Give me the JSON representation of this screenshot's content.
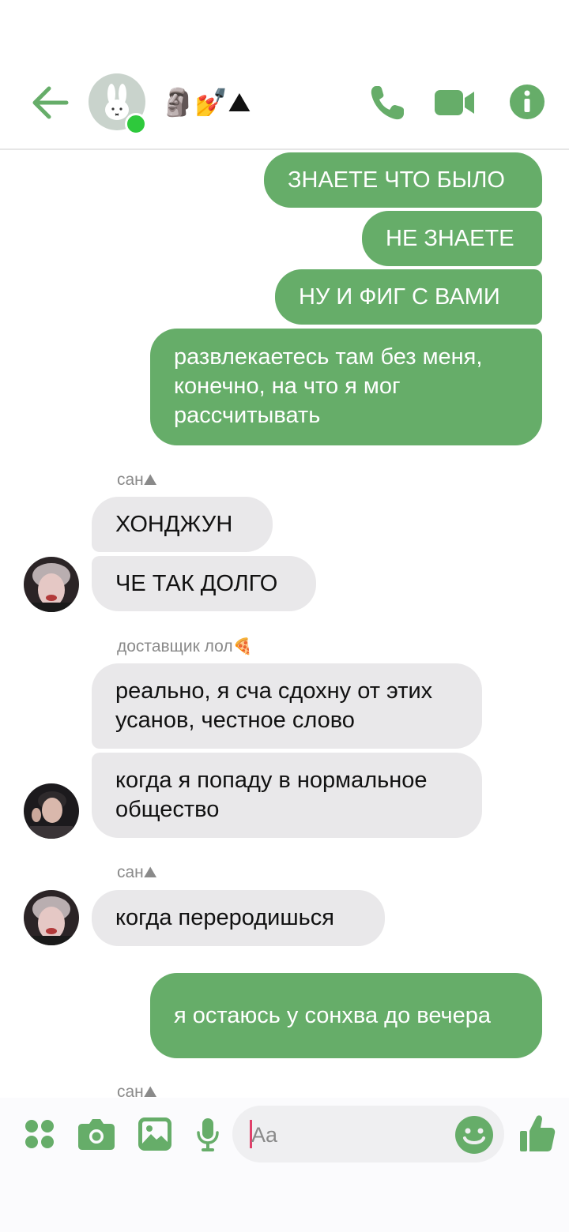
{
  "header": {
    "chat_title": "🗿💅⛰",
    "back_icon": "arrow-left-icon",
    "call_icon": "phone-icon",
    "video_icon": "video-camera-icon",
    "info_icon": "info-icon",
    "accent_color": "#66ad69"
  },
  "messages": [
    {
      "side": "out",
      "text": "ЗНАЕТЕ ЧТО БЫЛО"
    },
    {
      "side": "out",
      "text": "НЕ ЗНАЕТЕ"
    },
    {
      "side": "out",
      "text": "НУ И ФИГ С ВАМИ"
    },
    {
      "side": "out",
      "text": "развлекаетесь там без меня, конечно, на что я мог рассчитывать"
    },
    {
      "side": "in",
      "sender": "сан",
      "sender_emoji": "⛰",
      "texts": [
        "ХОНДЖУН",
        "ЧЕ ТАК ДОЛГО"
      ]
    },
    {
      "side": "in",
      "sender": "доставщик лол",
      "sender_emoji": "🍕",
      "texts": [
        "реально, я сча сдохну от этих усанов, честное слово",
        "когда я попаду в нормальное общество"
      ]
    },
    {
      "side": "in",
      "sender": "сан",
      "sender_emoji": "⛰",
      "texts": [
        "когда переродишься"
      ]
    },
    {
      "side": "out",
      "text": "я остаюсь у сонхва до вечера"
    },
    {
      "side": "in",
      "sender": "сан",
      "sender_emoji": "⛰",
      "texts": []
    }
  ],
  "composer": {
    "placeholder": "Aa",
    "apps_icon": "apps-grid-icon",
    "camera_icon": "camera-icon",
    "gallery_icon": "image-icon",
    "mic_icon": "microphone-icon",
    "emoji_icon": "smiley-icon",
    "like_icon": "thumbs-up-icon"
  }
}
